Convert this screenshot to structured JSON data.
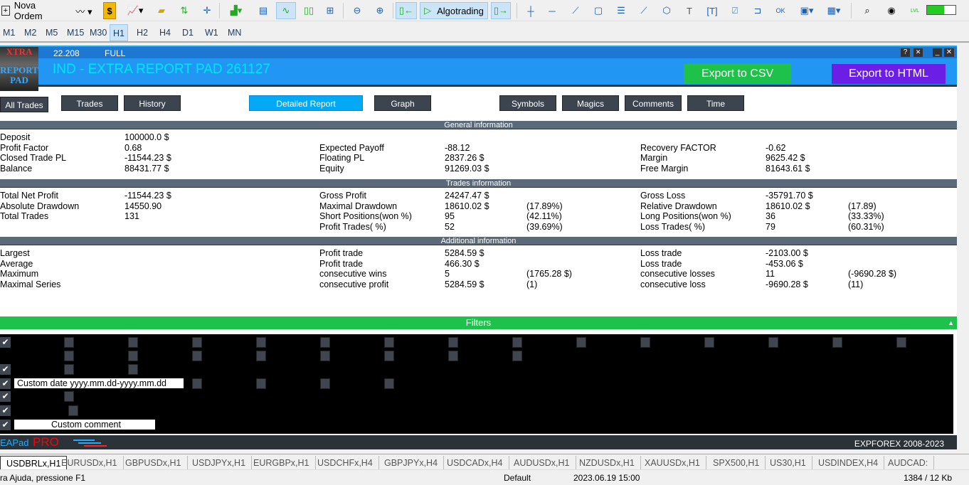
{
  "toolbar": {
    "new_order": "Nova Ordem",
    "algotrading": "Algotrading",
    "signal_label": "LVL"
  },
  "timeframes": [
    "M1",
    "M2",
    "M5",
    "M15",
    "M30",
    "H1",
    "H2",
    "H4",
    "D1",
    "W1",
    "MN"
  ],
  "active_timeframe": "H1",
  "panel": {
    "version": "22.208",
    "mode": "FULL",
    "title": "IND - EXTRA REPORT PAD 261127",
    "logo_text": [
      "XTRA",
      "REPORT",
      "PAD"
    ],
    "export_csv": "Export to CSV",
    "export_html": "Export to HTML",
    "nav": [
      "All Trades",
      "Trades",
      "History",
      "Detailed Report",
      "Graph",
      "Symbols",
      "Magics",
      "Comments",
      "Time"
    ],
    "active_nav": "Detailed Report",
    "sections": [
      {
        "title": "General information",
        "rows": [
          [
            "Deposit",
            "100000.0 $",
            "",
            "",
            "",
            "",
            "",
            ""
          ],
          [
            "Profit Factor",
            "0.68",
            "Expected Payoff",
            "-88.12",
            "",
            "Recovery FACTOR",
            "-0.62",
            ""
          ],
          [
            "Closed Trade PL",
            "-11544.23 $",
            "Floating PL",
            "2837.26 $",
            "",
            "Margin",
            "9625.42 $",
            ""
          ],
          [
            "Balance",
            "88431.77 $",
            "Equity",
            "91269.03 $",
            "",
            "Free Margin",
            "81643.61 $",
            ""
          ]
        ]
      },
      {
        "title": "Trades information",
        "rows": [
          [
            "Total Net Profit",
            "-11544.23 $",
            "Gross Profit",
            "24247.47 $",
            "",
            "Gross Loss",
            "-35791.70 $",
            ""
          ],
          [
            "Absolute Drawdown",
            "14550.90",
            "Maximal Drawdown",
            "18610.02 $",
            "(17.89%)",
            "Relative Drawdown",
            "18610.02 $",
            "(17.89)"
          ],
          [
            "Total Trades",
            "131",
            "Short Positions(won %)",
            "95",
            "(42.11%)",
            "Long Positions(won %)",
            "36",
            "(33.33%)"
          ],
          [
            "",
            "",
            "Profit Trades( %)",
            "52",
            "(39.69%)",
            "Loss Trades( %)",
            "79",
            "(60.31%)"
          ]
        ]
      },
      {
        "title": "Additional information",
        "rows": [
          [
            "Largest",
            "",
            "Profit trade",
            "5284.59 $",
            "",
            "Loss trade",
            "-2103.00 $",
            ""
          ],
          [
            "Average",
            "",
            "Profit trade",
            "466.30 $",
            "",
            "Loss trade",
            "-453.06 $",
            ""
          ],
          [
            "Maximum",
            "",
            "consecutive wins",
            "5",
            "(1765.28 $)",
            "consecutive losses",
            "11",
            "(-9690.28 $)"
          ],
          [
            "Maximal Series",
            "",
            "consecutive profit",
            "5284.59 $",
            "(1)",
            "consecutive loss",
            "-9690.28 $",
            "(11)"
          ]
        ]
      }
    ],
    "filters_label": "Filters",
    "custom_date": "Custom date yyyy.mm.dd-yyyy.mm.dd",
    "custom_comment": "Custom comment",
    "brand_left": "EAPad",
    "brand_pro": "PRO",
    "copyright": "EXPFOREX 2008-2023",
    "colors": {
      "header": "#2196f3",
      "csv": "#1ec24a",
      "html": "#6a1ee6",
      "filters": "#1ec24a",
      "title_text": "#00e5ff"
    }
  },
  "chart_tabs": [
    "USDBRLx,H1",
    "EURUSDx,H1",
    "GBPUSDx,H1",
    "USDJPYx,H1",
    "EURGBPx,H1",
    "USDCHFx,H4",
    "GBPJPYx,H4",
    "USDCADx,H4",
    "AUDUSDx,H1",
    "NZDUSDx,H1",
    "XAUUSDx,H1",
    "SPX500,H1",
    "US30,H1",
    "USDINDEX,H4",
    "AUDCAD:"
  ],
  "status": {
    "help": "ra Ajuda, pressione F1",
    "profile": "Default",
    "datetime": "2023.06.19 15:00",
    "traffic": "1384 / 12 Kb"
  }
}
